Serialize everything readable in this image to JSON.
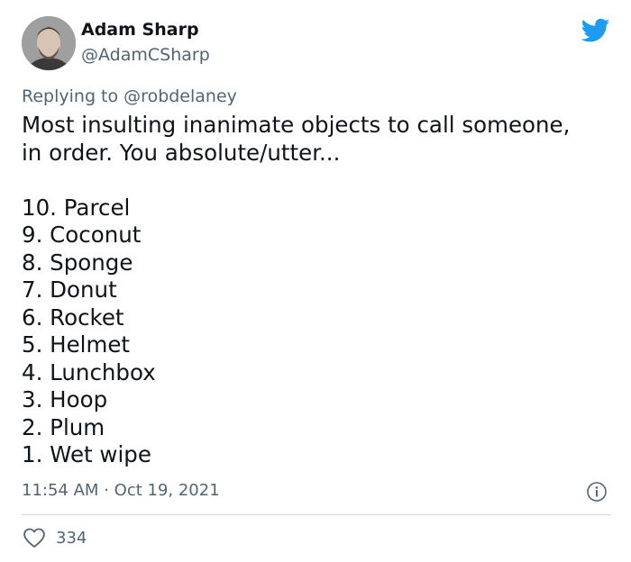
{
  "author": {
    "display_name": "Adam Sharp",
    "handle": "@AdamCSharp"
  },
  "reply": {
    "prefix": "Replying to",
    "user": "@robdelaney"
  },
  "tweet": {
    "line1": "Most insulting inanimate objects to call someone,",
    "line2": "in order. You absolute/utter...",
    "items": [
      "10. Parcel",
      "9. Coconut",
      "8. Sponge",
      "7. Donut",
      "6. Rocket",
      "5. Helmet",
      "4. Lunchbox",
      "3. Hoop",
      "2. Plum",
      "1. Wet wipe"
    ]
  },
  "meta": {
    "time": "11:54 AM",
    "separator": "·",
    "date": "Oct 19, 2021"
  },
  "likes": {
    "count": "334"
  },
  "icons": {
    "brand": "twitter-bird-icon",
    "info": "info-icon",
    "like": "heart-icon"
  },
  "colors": {
    "brand": "#1d9bf0",
    "text_primary": "#0f1419",
    "text_secondary": "#536471",
    "divider": "#cfd9de"
  }
}
